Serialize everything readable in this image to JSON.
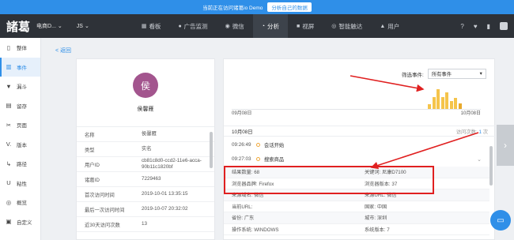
{
  "banner": {
    "text": "当前正在访问诸葛io Demo",
    "button": "分析自己的数据"
  },
  "topnav": {
    "logo": "諸葛",
    "project": "电商D...",
    "project2": "JS",
    "tabs": [
      {
        "label": "看板",
        "icon": "dashboard-icon",
        "glyph": "▦"
      },
      {
        "label": "广告监测",
        "icon": "ad-icon",
        "glyph": "●"
      },
      {
        "label": "微信",
        "icon": "wechat-icon",
        "glyph": "◉"
      },
      {
        "label": "分析",
        "icon": "analysis-icon",
        "glyph": "◔"
      },
      {
        "label": "视屏",
        "icon": "video-icon",
        "glyph": "■"
      },
      {
        "label": "智能触达",
        "icon": "reach-icon",
        "glyph": "◎"
      },
      {
        "label": "用户",
        "icon": "user-icon",
        "glyph": "▲"
      }
    ],
    "active_tab": "分析"
  },
  "sidebar": {
    "items": [
      {
        "label": "整体",
        "icon": "overall-icon",
        "glyph": "▯"
      },
      {
        "label": "事件",
        "icon": "event-icon",
        "glyph": "▥"
      },
      {
        "label": "漏斗",
        "icon": "funnel-icon",
        "glyph": "▼"
      },
      {
        "label": "留存",
        "icon": "retention-icon",
        "glyph": "▤"
      },
      {
        "label": "页面",
        "icon": "page-icon",
        "glyph": "✂"
      },
      {
        "label": "版本",
        "icon": "version-icon",
        "glyph": "V."
      },
      {
        "label": "路径",
        "icon": "path-icon",
        "glyph": "↳"
      },
      {
        "label": "粘性",
        "icon": "stickiness-icon",
        "glyph": "U"
      },
      {
        "label": "概览",
        "icon": "overview-icon",
        "glyph": "◎"
      },
      {
        "label": "自定义",
        "icon": "custom-icon",
        "glyph": "▣"
      }
    ],
    "active": "事件"
  },
  "back_link": "< 返回",
  "profile": {
    "avatar_char": "侯",
    "name": "侯馨雁",
    "attributes": [
      {
        "key": "名称",
        "value": "侯馨雁"
      },
      {
        "key": "类型",
        "value": "实名"
      },
      {
        "key": "用户ID",
        "value": "cb81c8d0-ccd2-11e6-acca-90b11c1820bf"
      },
      {
        "key": "诸葛ID",
        "value": "7229463"
      },
      {
        "key": "首次访问时间",
        "value": "2019-10-01 13:35:15"
      },
      {
        "key": "最后一次访问时间",
        "value": "2019-10-07 20:32:02"
      },
      {
        "key": "近30天访问次数",
        "value": "13"
      }
    ]
  },
  "events": {
    "filter_label": "筛选事件:",
    "filter_value": "所有事件",
    "date_start": "09月08日",
    "date_end": "10月08日",
    "activity_bars": [
      0.2,
      0.55,
      0.9,
      0.55,
      0.75,
      0.35,
      0.5,
      0.25
    ],
    "list_date": "10月08日",
    "visit_count_label": "访问次数:",
    "visit_count_value": "1",
    "visit_count_unit": "次",
    "rows": [
      {
        "time": "09:26:49",
        "name": "会话开始"
      },
      {
        "time": "09:27:03",
        "name": "搜索商品"
      }
    ],
    "details": [
      {
        "left": "结果数量: 68",
        "right": "关键词: 尼康D7100"
      },
      {
        "left": "浏览器品牌: Firefox",
        "right": "浏览器版本: 37"
      },
      {
        "left": "来源域名: 微信",
        "right": "来源URL: 微信"
      },
      {
        "left": "当前URL:",
        "right": "国家: 中国"
      },
      {
        "left": "省份: 广东",
        "right": "城市: 深圳"
      },
      {
        "left": "操作系统: WINDOWS",
        "right": "系统版本: 7"
      }
    ]
  },
  "colors": {
    "accent": "#2f8fe8",
    "nav_bg": "#2e3238",
    "highlight_box": "#e02020",
    "bar": "#f5c44b",
    "avatar": "#a3558e"
  }
}
